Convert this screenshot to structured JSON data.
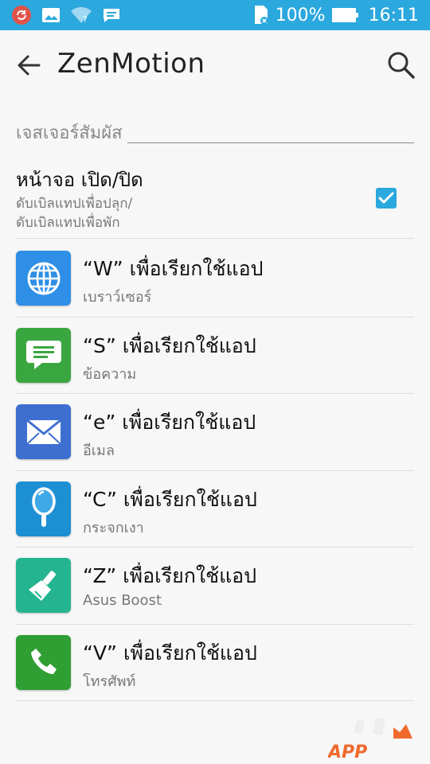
{
  "status_bar": {
    "battery_text": "100%",
    "time": "16:11"
  },
  "app_bar": {
    "title": "ZenMotion"
  },
  "section": {
    "title": "เจสเจอร์สัมผัส"
  },
  "toggle": {
    "title": "หน้าจอ เปิด/ปิด",
    "subtitle_line1": "ดับเบิลแทปเพื่อปลุก/",
    "subtitle_line2": "ดับเบิลแทปเพื่อพัก",
    "checked": true
  },
  "gestures": [
    {
      "title": "“W” เพื่อเรียกใช้แอป",
      "subtitle": "เบราว์เซอร์",
      "icon": "globe-icon",
      "color": "#2f8fe6"
    },
    {
      "title": "“S” เพื่อเรียกใช้แอป",
      "subtitle": "ข้อความ",
      "icon": "message-icon",
      "color": "#3aa640"
    },
    {
      "title": "“e” เพื่อเรียกใช้แอป",
      "subtitle": "อีเมล",
      "icon": "mail-icon",
      "color": "#3e6fd0"
    },
    {
      "title": "“C” เพื่อเรียกใช้แอป",
      "subtitle": "กระจกเงา",
      "icon": "mirror-icon",
      "color": "#1d8fd3"
    },
    {
      "title": "“Z” เพื่อเรียกใช้แอป",
      "subtitle": "Asus Boost",
      "icon": "broom-icon",
      "color": "#25b490"
    },
    {
      "title": "“V” เพื่อเรียกใช้แอป",
      "subtitle": "โทรศัพท์",
      "icon": "phone-icon",
      "color": "#2f9e33"
    }
  ],
  "watermark": {
    "text": "APP"
  },
  "colors": {
    "accent": "#2ba8dd",
    "background": "#f7f7f7"
  }
}
